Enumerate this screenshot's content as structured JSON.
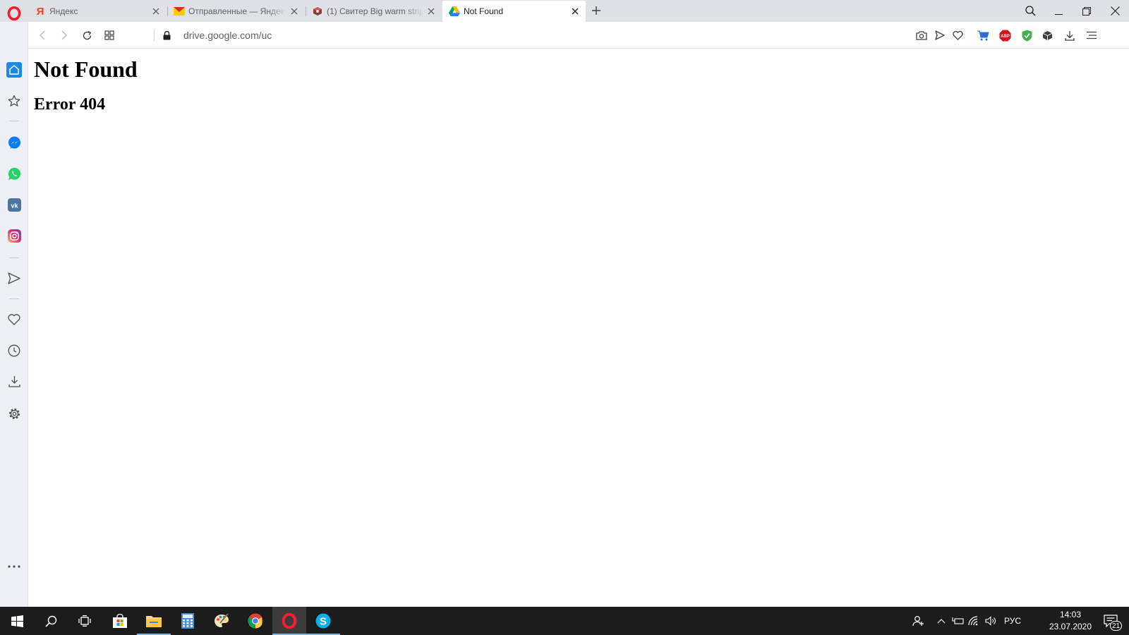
{
  "browser": {
    "brand_color": "#ff1b2d",
    "tabs": [
      {
        "title": "Яндекс",
        "icon": "yandex-icon",
        "active": false
      },
      {
        "title": "Отправленные — Яндекс.Почта",
        "icon": "yandex-mail-icon",
        "active": false
      },
      {
        "title": "(1) Свитер Big warm strip",
        "icon": "shop-icon",
        "active": false
      },
      {
        "title": "Not Found",
        "icon": "google-drive-icon",
        "active": true
      }
    ],
    "address": {
      "url": "drive.google.com/uc"
    }
  },
  "page": {
    "heading": "Not Found",
    "subheading": "Error 404"
  },
  "sidebar": {
    "items": [
      "home-icon",
      "bookmarks-icon",
      "messenger-icon",
      "whatsapp-icon",
      "vk-icon",
      "instagram-icon",
      "my-flow-icon",
      "favorites-icon",
      "history-icon",
      "downloads-icon",
      "settings-icon",
      "more-icon"
    ]
  },
  "extensions": {
    "abp_label": "ABP"
  },
  "taskbar": {
    "apps": [
      "start-icon",
      "search-icon",
      "task-view-icon",
      "store-icon",
      "file-explorer-icon",
      "calculator-icon",
      "paint-icon",
      "chrome-icon",
      "opera-icon",
      "skype-icon"
    ],
    "language": "РУС",
    "time": "14:03",
    "date": "23.07.2020",
    "notifications": "21"
  }
}
